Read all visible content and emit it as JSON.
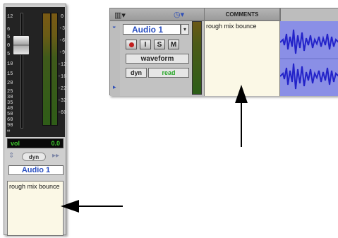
{
  "mix_strip": {
    "fader_scale": [
      "12",
      "6",
      "5",
      "0",
      "5",
      "10",
      "15",
      "20",
      "25",
      "30",
      "35",
      "40",
      "50",
      "60",
      "90",
      "∞"
    ],
    "meter_scale": [
      "0",
      "-3",
      "-6",
      "-9",
      "-12",
      "-16",
      "-22",
      "-32",
      "-60"
    ],
    "volume_label": "vol",
    "volume_value": "0.0",
    "dyn_label": "dyn",
    "track_name": "Audio 1",
    "comments_text": "rough mix bounce",
    "icons": [
      "stepper-arrows-icon",
      "send-arrow-icon"
    ]
  },
  "edit_window": {
    "comments_header": "COMMENTS",
    "track_name": "Audio 1",
    "buttons": {
      "input": "I",
      "solo": "S",
      "mute": "M"
    },
    "view_select": "waveform",
    "dyn_label": "dyn",
    "automation_select": "read",
    "comments_text": "rough mix bounce",
    "icons": [
      "view-menu-icon",
      "clock-icon",
      "dropdown-arrow-icon",
      "record-enable-icon"
    ]
  },
  "colors": {
    "track_name_text": "#2a4fc1",
    "vol_text": "#3ecb2e",
    "read_text": "#2aa82a",
    "waveform_bg": "#8a8fe6",
    "waveform": "#2323c9",
    "comments_bg": "#fbf8e6",
    "record_button": "#c11e1e"
  }
}
